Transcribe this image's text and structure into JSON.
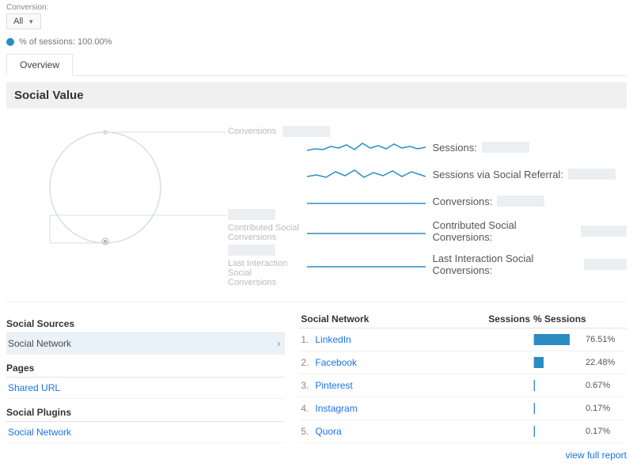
{
  "conversion": {
    "label": "Conversion:",
    "selected": "All"
  },
  "legend": {
    "text": "% of sessions: 100.00%"
  },
  "tabs": {
    "overview": "Overview"
  },
  "section_title": "Social Value",
  "left_metrics": [
    {
      "label": "Conversions"
    },
    {
      "label": "Contributed Social Conversions"
    },
    {
      "label": "Last Interaction Social Conversions"
    }
  ],
  "metrics": [
    {
      "label": "Sessions:"
    },
    {
      "label": "Sessions via Social Referral:"
    },
    {
      "label": "Conversions:"
    },
    {
      "label": "Contributed Social Conversions:"
    },
    {
      "label": "Last Interaction Social Conversions:"
    }
  ],
  "left_panel": {
    "groups": [
      {
        "heading": "Social Sources",
        "items": [
          {
            "label": "Social Network",
            "active": true
          }
        ]
      },
      {
        "heading": "Pages",
        "items": [
          {
            "label": "Shared URL",
            "active": false
          }
        ]
      },
      {
        "heading": "Social Plugins",
        "items": [
          {
            "label": "Social Network",
            "active": false
          }
        ]
      }
    ]
  },
  "table": {
    "cols": {
      "network": "Social Network",
      "sessions": "Sessions",
      "pct": "% Sessions"
    },
    "rows": [
      {
        "idx": "1.",
        "name": "LinkedIn",
        "pct_txt": "76.51%",
        "pct": 76.51
      },
      {
        "idx": "2.",
        "name": "Facebook",
        "pct_txt": "22.48%",
        "pct": 22.48
      },
      {
        "idx": "3.",
        "name": "Pinterest",
        "pct_txt": "0.67%",
        "pct": 0.67
      },
      {
        "idx": "4.",
        "name": "Instagram",
        "pct_txt": "0.17%",
        "pct": 0.17
      },
      {
        "idx": "5.",
        "name": "Quora",
        "pct_txt": "0.17%",
        "pct": 0.17
      }
    ]
  },
  "full_report": "view full report"
}
